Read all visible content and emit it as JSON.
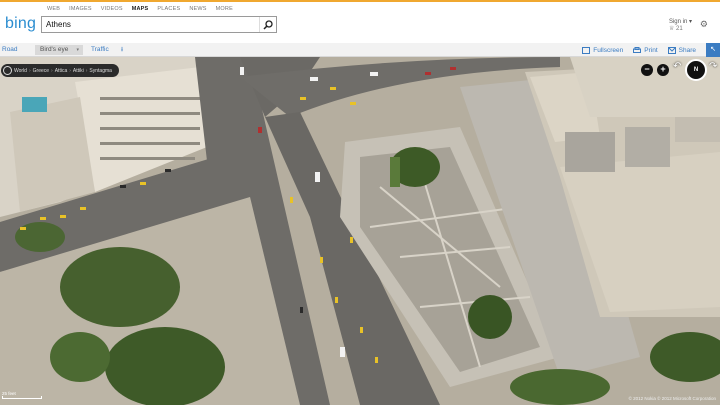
{
  "header": {
    "logo": "bing",
    "scopes": [
      {
        "label": "WEB",
        "active": false
      },
      {
        "label": "IMAGES",
        "active": false
      },
      {
        "label": "VIDEOS",
        "active": false
      },
      {
        "label": "MAPS",
        "active": true
      },
      {
        "label": "PLACES",
        "active": false
      },
      {
        "label": "NEWS",
        "active": false
      },
      {
        "label": "MORE",
        "active": false
      }
    ],
    "search_value": "Athens",
    "signin_label": "Sign in ▾",
    "rewards_points": "21"
  },
  "toolbar": {
    "road": "Road",
    "birds_eye": "Bird's eye",
    "traffic": "Traffic",
    "fullscreen": "Fullscreen",
    "print": "Print",
    "share": "Share"
  },
  "map": {
    "breadcrumb": [
      "World",
      "Greece",
      "Attica",
      "Attiki",
      "Syntagma"
    ],
    "compass_label": "N",
    "scale_label": "25 feet",
    "copyright": "© 2012 Nokia   © 2012 Microsoft Corporation"
  },
  "colors": {
    "accent": "#3b7cc2",
    "logo": "#2b8dd0",
    "topline": "#f0a830"
  }
}
